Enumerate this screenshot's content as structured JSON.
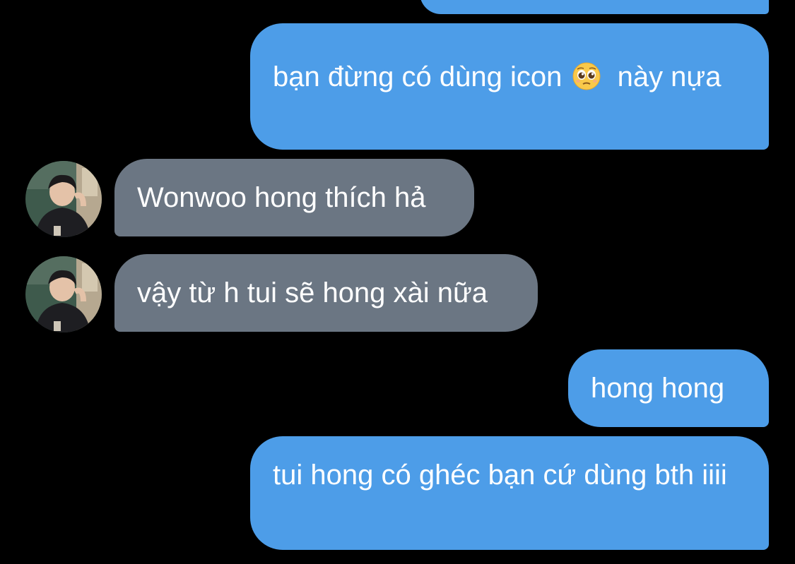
{
  "conversation": {
    "messages": [
      {
        "id": "m0",
        "direction": "outgoing",
        "text": ""
      },
      {
        "id": "m1",
        "direction": "outgoing",
        "text_before_emoji": "bạn đừng có dùng icon",
        "emoji": "pleading-face-emoji",
        "text_after_emoji": " này nựa"
      },
      {
        "id": "m2",
        "direction": "incoming",
        "text": "Wonwoo hong thích hả"
      },
      {
        "id": "m3",
        "direction": "incoming",
        "text": "vậy từ h tui sẽ hong xài nữa"
      },
      {
        "id": "m4",
        "direction": "outgoing",
        "text": "hong hong"
      },
      {
        "id": "m5",
        "direction": "outgoing",
        "text": "tui hong có ghéc bạn cứ dùng bth iiii"
      }
    ]
  },
  "colors": {
    "background": "#000000",
    "outgoing_bubble": "#4d9de8",
    "incoming_bubble": "#6b7683",
    "text": "#ffffff"
  },
  "icons": {
    "avatar": "contact-avatar-photo",
    "emoji": "pleading-face-emoji"
  }
}
